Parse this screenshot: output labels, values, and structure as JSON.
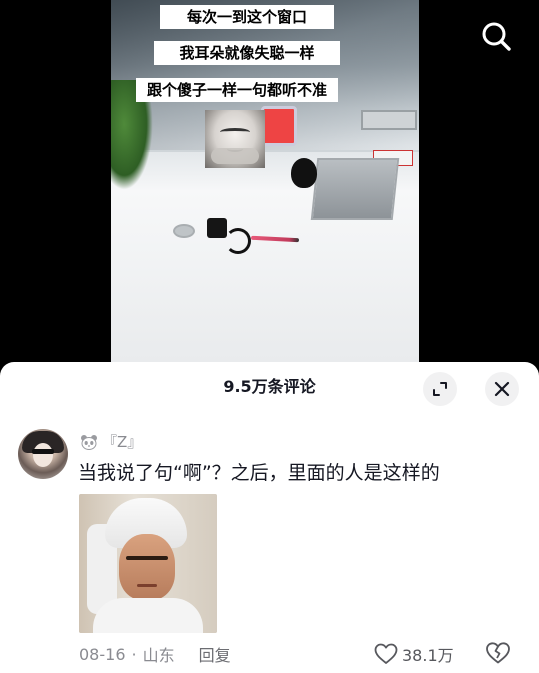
{
  "video": {
    "captions": [
      "每次一到这个窗口",
      "我耳朵就像失聪一样",
      "跟个傻子一样一句都听不准"
    ]
  },
  "comments_panel": {
    "title": "9.5万条评论"
  },
  "comment": {
    "username": "『Z』",
    "text": "当我说了句“啊”？之后，里面的人是这样的",
    "date": "08-16",
    "separator": "·",
    "location": "山东",
    "reply_label": "回复",
    "like_count": "38.1万"
  },
  "icons": {
    "search": "search-icon",
    "expand": "expand-icon",
    "close": "close-icon",
    "like": "heart-icon",
    "dislike": "broken-heart-icon",
    "user_badge": "panda-icon"
  },
  "colors": {
    "sheet_background": "#ffffff",
    "primary_text": "#161823",
    "secondary_text": "#8a8b91"
  }
}
